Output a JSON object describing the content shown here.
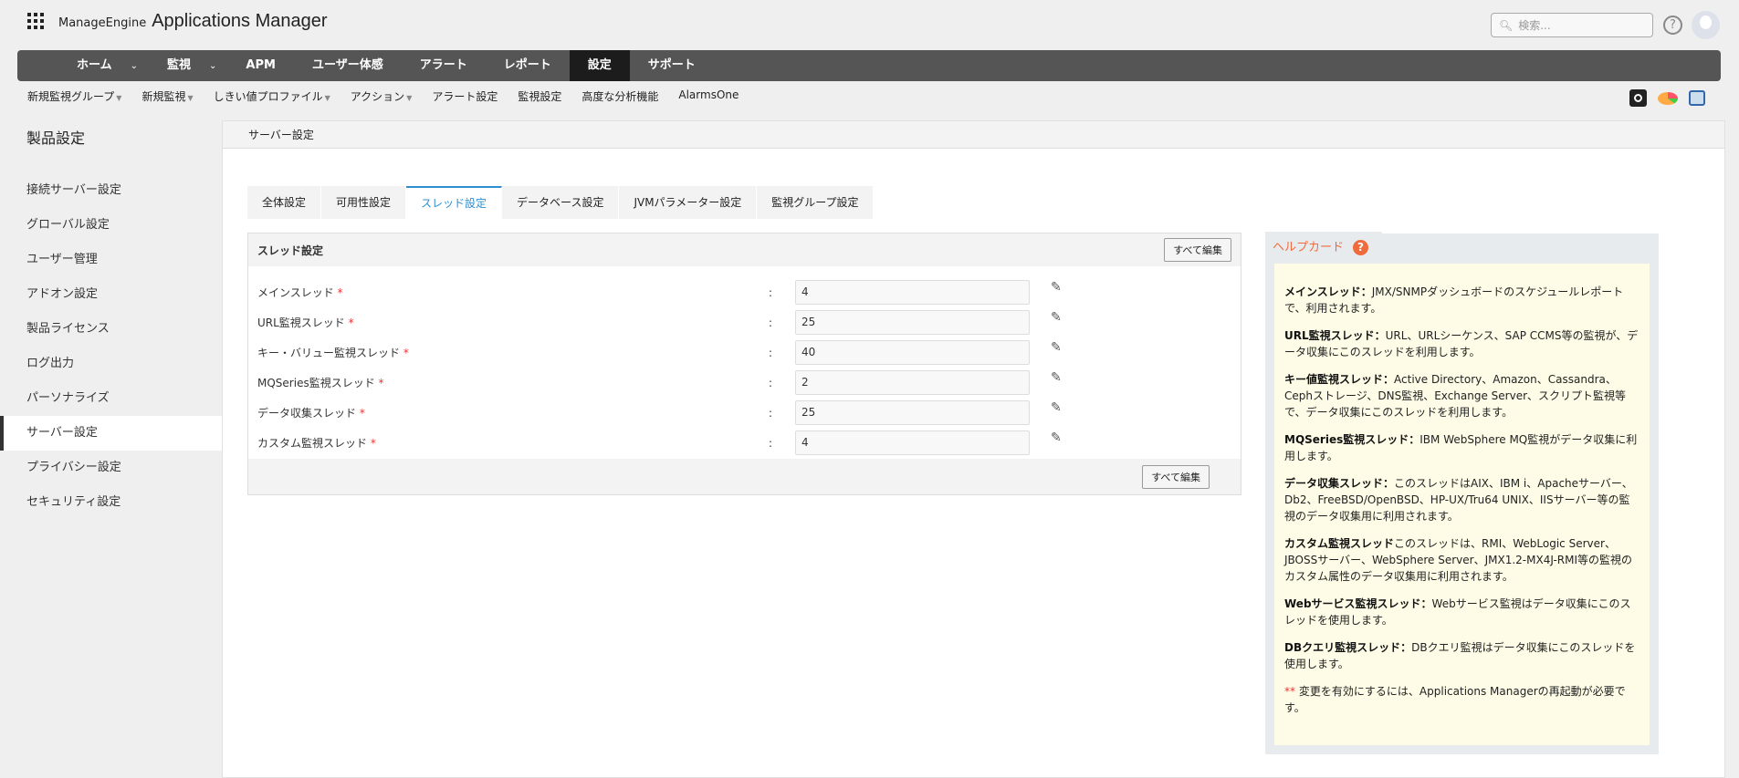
{
  "header": {
    "brand": "ManageEngine",
    "app_title": "Applications Manager",
    "search_placeholder": "検索..."
  },
  "nav": {
    "items": [
      {
        "label": "ホーム",
        "chevron": true
      },
      {
        "label": "監視",
        "chevron": true
      },
      {
        "label": "APM"
      },
      {
        "label": "ユーザー体感"
      },
      {
        "label": "アラート"
      },
      {
        "label": "レポート"
      },
      {
        "label": "設定",
        "active": true
      },
      {
        "label": "サポート"
      }
    ]
  },
  "subnav": {
    "items": [
      {
        "label": "新規監視グループ",
        "caret": true
      },
      {
        "label": "新規監視",
        "caret": true
      },
      {
        "label": "しきい値プロファイル",
        "caret": true
      },
      {
        "label": "アクション",
        "caret": true
      },
      {
        "label": "アラート設定"
      },
      {
        "label": "監視設定"
      },
      {
        "label": "高度な分析機能"
      },
      {
        "label": "AlarmsOne"
      }
    ]
  },
  "sidebar": {
    "title": "製品設定",
    "items": [
      "接続サーバー設定",
      "グローバル設定",
      "ユーザー管理",
      "アドオン設定",
      "製品ライセンス",
      "ログ出力",
      "パーソナライズ",
      "サーバー設定",
      "プライバシー設定",
      "セキュリティ設定"
    ],
    "active": "サーバー設定"
  },
  "main": {
    "title": "サーバー設定",
    "tabs": [
      "全体設定",
      "可用性設定",
      "スレッド設定",
      "データベース設定",
      "JVMパラメーター設定",
      "監視グループ設定"
    ],
    "active_tab": "スレッド設定",
    "section": {
      "title": "スレッド設定",
      "edit_all": "すべて編集",
      "required_mark": "*",
      "colon": ":",
      "rows": [
        {
          "label": "メインスレッド",
          "value": "4"
        },
        {
          "label": "URL監視スレッド",
          "value": "25"
        },
        {
          "label": "キー・バリュー監視スレッド",
          "value": "40"
        },
        {
          "label": "MQSeries監視スレッド",
          "value": "2"
        },
        {
          "label": "データ収集スレッド",
          "value": "25"
        },
        {
          "label": "カスタム監視スレッド",
          "value": "4"
        }
      ]
    }
  },
  "help": {
    "title": "ヘルプカード",
    "q": "?",
    "entries": [
      {
        "term": "メインスレッド：",
        "desc": "JMX/SNMPダッシュボードのスケジュールレポートで、利用されます。"
      },
      {
        "term": "URL監視スレッド：",
        "desc": "URL、URLシーケンス、SAP CCMS等の監視が、データ収集にこのスレッドを利用します。"
      },
      {
        "term": "キー値監視スレッド：",
        "desc": "Active Directory、Amazon、Cassandra、Cephストレージ、DNS監視、Exchange Server、スクリプト監視等で、データ収集にこのスレッドを利用します。"
      },
      {
        "term": "MQSeries監視スレッド：",
        "desc": "IBM WebSphere MQ監視がデータ収集に利用します。"
      },
      {
        "term": "データ収集スレッド：",
        "desc": "このスレッドはAIX、IBM i、Apacheサーバー、Db2、FreeBSD/OpenBSD、HP-UX/Tru64 UNIX、IISサーバー等の監視のデータ収集用に利用されます。"
      },
      {
        "term": "カスタム監視スレッド",
        "desc": "このスレッドは、RMI、WebLogic Server、JBOSSサーバー、WebSphere Server、JMX1.2-MX4J-RMI等の監視のカスタム属性のデータ収集用に利用されます。"
      },
      {
        "term": "Webサービス監視スレッド：",
        "desc": "Webサービス監視はデータ収集にこのスレッドを使用します。"
      },
      {
        "term": "DBクエリ監視スレッド：",
        "desc": "DBクエリ監視はデータ収集にこのスレッドを使用します。"
      }
    ],
    "note_mark": "**",
    "note": " 変更を有効にするには、Applications Managerの再起動が必要です。"
  }
}
